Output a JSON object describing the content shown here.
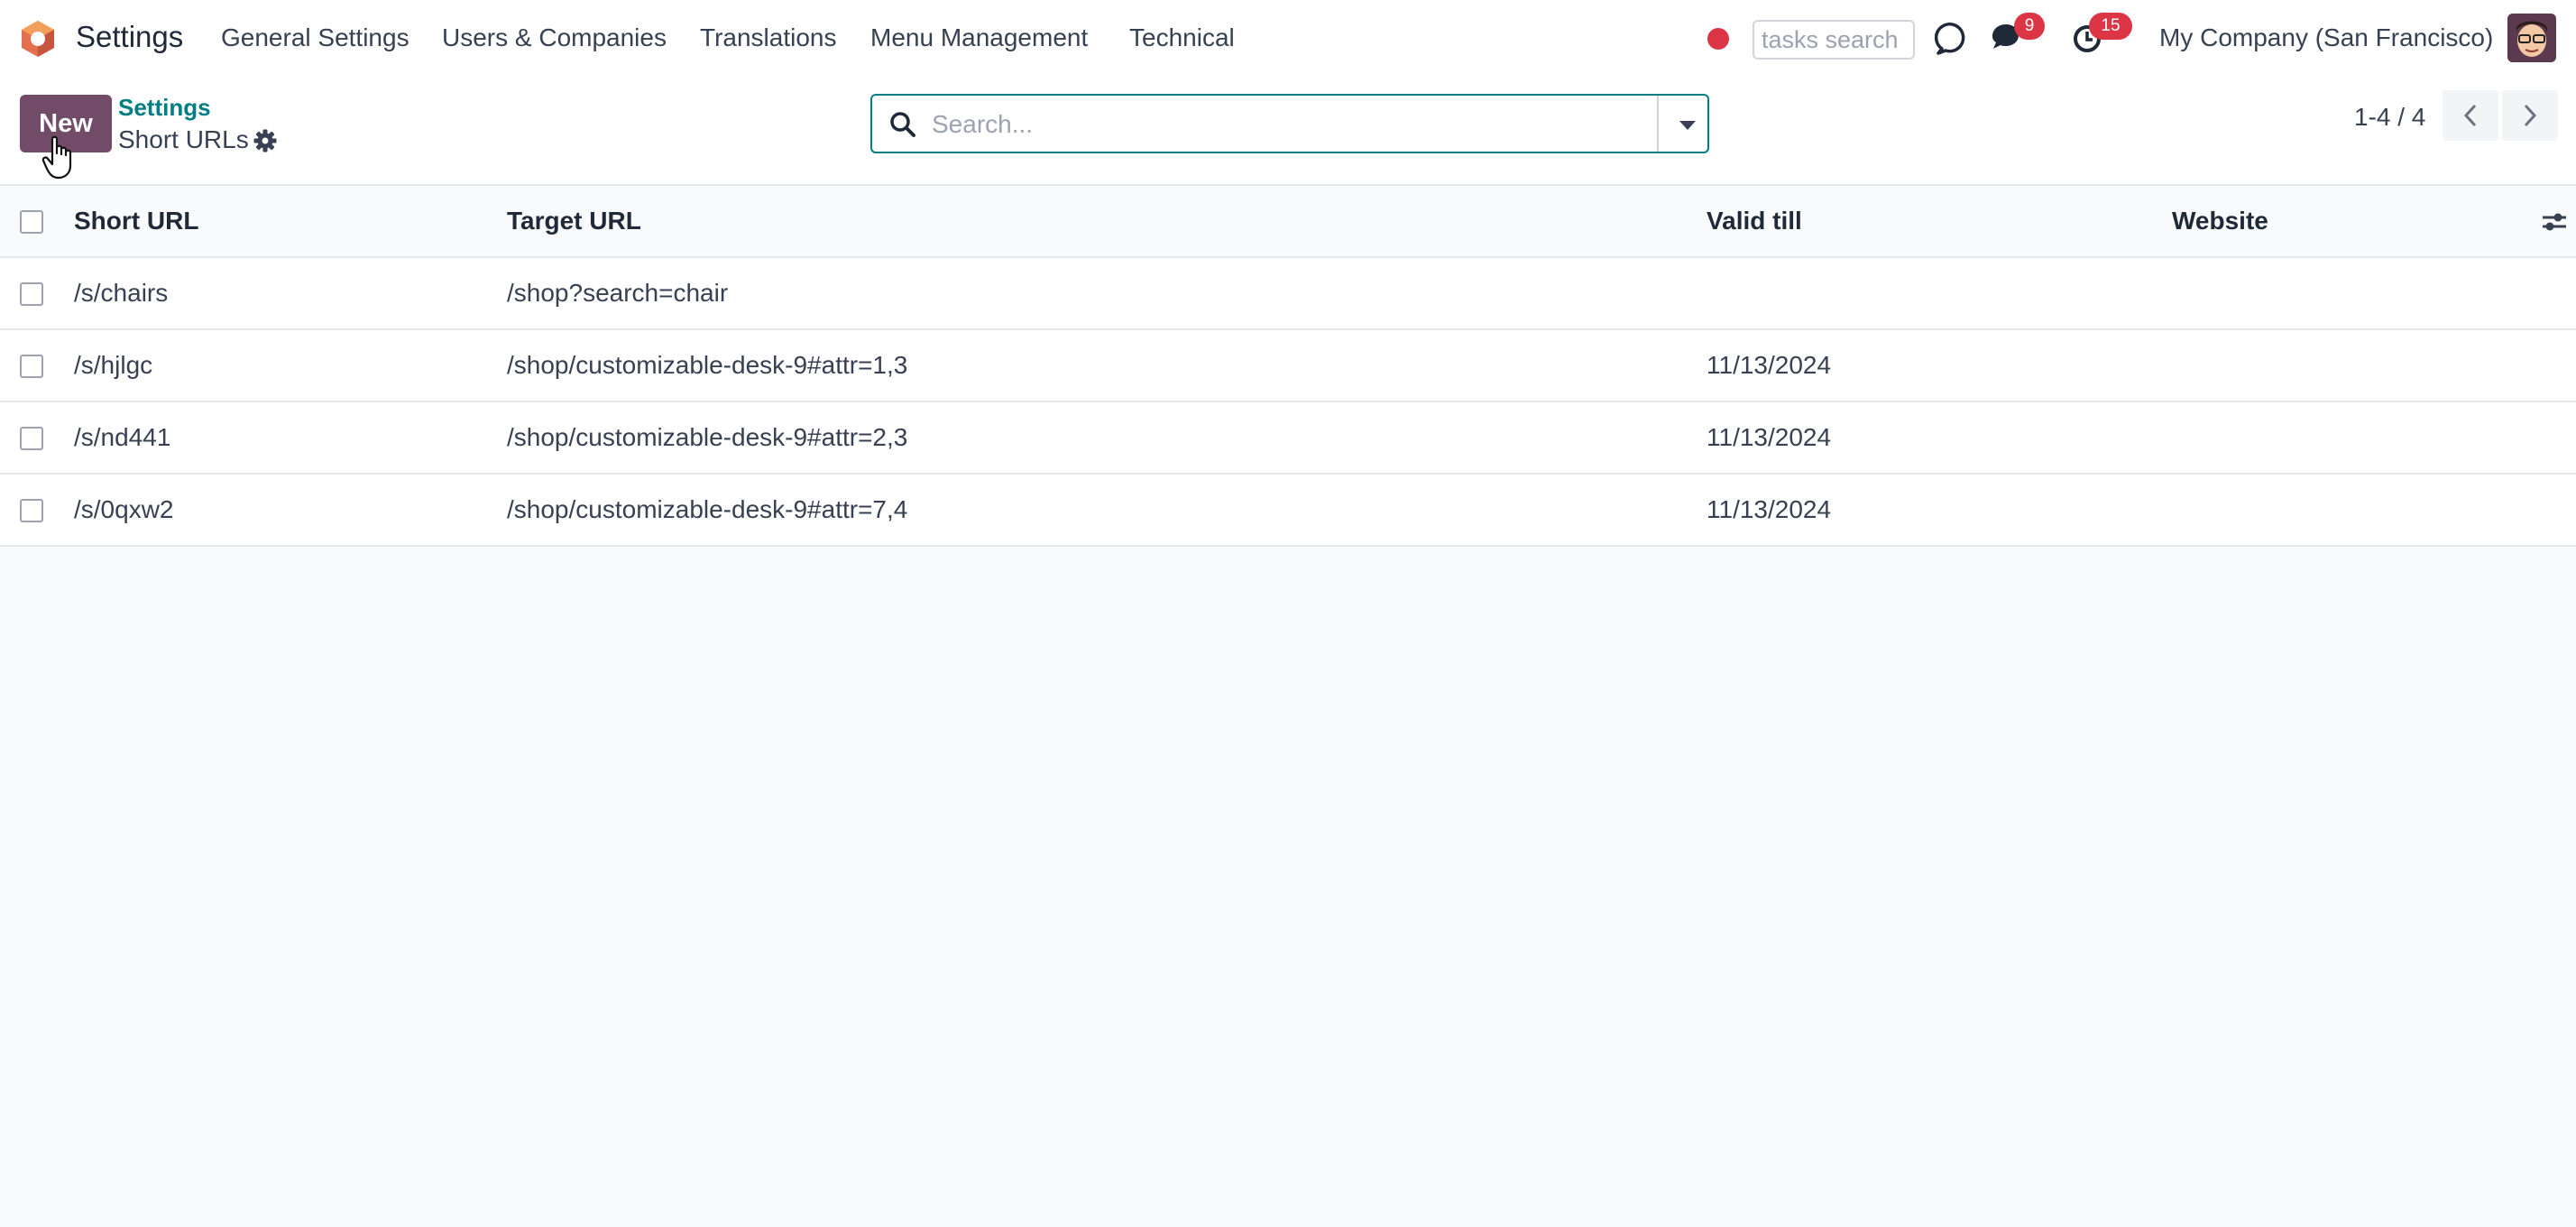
{
  "navbar": {
    "app_name": "Settings",
    "menu": [
      {
        "label": "General Settings"
      },
      {
        "label": "Users & Companies"
      },
      {
        "label": "Translations"
      },
      {
        "label": "Menu Management"
      },
      {
        "label": "Technical"
      }
    ],
    "tasks_search_placeholder": "tasks search",
    "messages_count": "9",
    "activities_count": "15",
    "company": "My Company (San Francisco)"
  },
  "control_panel": {
    "new_label": "New",
    "breadcrumb_parent": "Settings",
    "breadcrumb_current": "Short URLs",
    "search_placeholder": "Search...",
    "pager_value": "1-4 / 4"
  },
  "table": {
    "headers": {
      "short_url": "Short URL",
      "target_url": "Target URL",
      "valid_till": "Valid till",
      "website": "Website"
    },
    "rows": [
      {
        "short_url": "/s/chairs",
        "target_url": "/shop?search=chair",
        "valid_till": "",
        "website": ""
      },
      {
        "short_url": "/s/hjlgc",
        "target_url": "/shop/customizable-desk-9#attr=1,3",
        "valid_till": "11/13/2024",
        "website": ""
      },
      {
        "short_url": "/s/nd441",
        "target_url": "/shop/customizable-desk-9#attr=2,3",
        "valid_till": "11/13/2024",
        "website": ""
      },
      {
        "short_url": "/s/0qxw2",
        "target_url": "/shop/customizable-desk-9#attr=7,4",
        "valid_till": "11/13/2024",
        "website": ""
      }
    ]
  },
  "colors": {
    "brand": "#714b67",
    "accent": "#017e84",
    "badge": "#dc3545"
  }
}
